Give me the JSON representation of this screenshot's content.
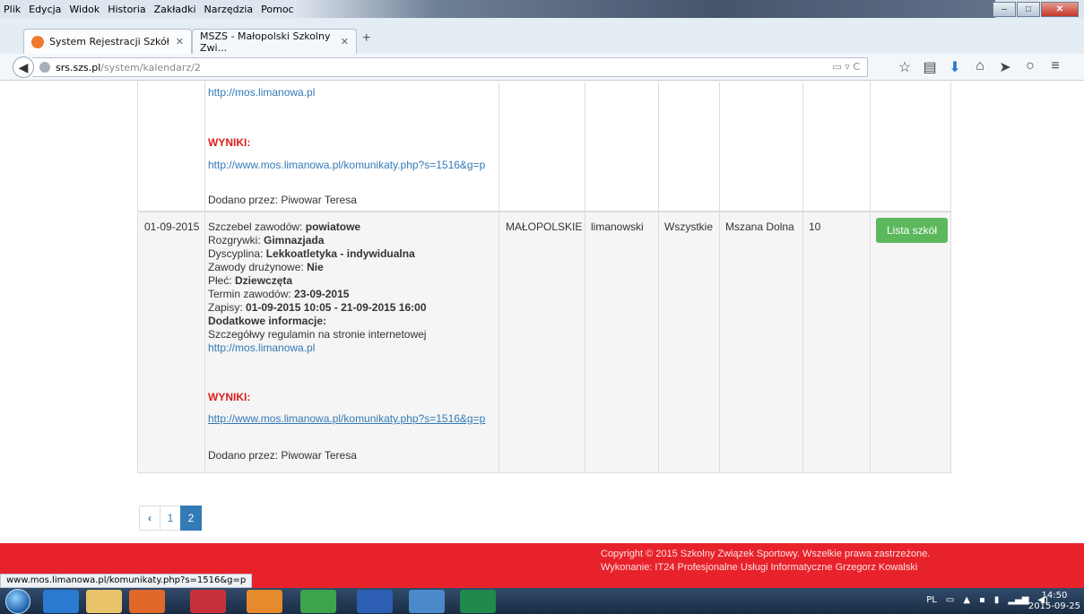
{
  "browser": {
    "menu": [
      "Plik",
      "Edycja",
      "Widok",
      "Historia",
      "Zakładki",
      "Narzędzia",
      "Pomoc"
    ],
    "tabs": [
      {
        "label": "System Rejestracji Szkół",
        "active": true
      },
      {
        "label": "MSZS - Małopolski Szkolny Zwi...",
        "active": false
      }
    ],
    "url_domain": "srs.szs.pl",
    "url_path": "/system/kalendarz/2",
    "status_link": "www.mos.limanowa.pl/komunikaty.php?s=1516&g=p"
  },
  "row1": {
    "link_main": "http://mos.limanowa.pl",
    "results_label": "WYNIKI:",
    "results_link": "http://www.mos.limanowa.pl/komunikaty.php?s=1516&g=p",
    "added_by": "Dodano przez: Piwowar Teresa"
  },
  "row2": {
    "date": "01-09-2015",
    "level_label": "Szczebel zawodów: ",
    "level_value": "powiatowe",
    "games_label": "Rozgrywki: ",
    "games_value": "Gimnazjada",
    "discipline_label": "Dyscyplina: ",
    "discipline_value": "Lekkoatletyka - indywidualna",
    "team_label": "Zawody drużynowe: ",
    "team_value": "Nie",
    "sex_label": "Płeć: ",
    "sex_value": "Dziewczęta",
    "term_label": "Termin zawodów: ",
    "term_value": "23-09-2015",
    "signup_label": "Zapisy: ",
    "signup_value": "01-09-2015 10:05 - 21-09-2015 16:00",
    "extra_label": "Dodatkowe informacje:",
    "extra_text": "Szczegółwy regulamin na stronie internetowej",
    "link_main": "http://mos.limanowa.pl",
    "results_label": "WYNIKI:",
    "results_link": "http://www.mos.limanowa.pl/komunikaty.php?s=1516&g=p",
    "added_by": "Dodano przez: Piwowar Teresa",
    "region": "MAŁOPOLSKIE",
    "county": "limanowski",
    "category": "Wszystkie",
    "town": "Mszana Dolna",
    "count": "10",
    "schools_button": "Lista szkół"
  },
  "pagination": {
    "prev": "‹",
    "pages": [
      "1",
      "2"
    ],
    "active": "2"
  },
  "footer": {
    "copyright": "Copyright © 2015 Szkolny Związek Sportowy. Wszelkie prawa zastrzeżone.",
    "made_by": "Wykonanie: IT24 Profesjonalne Usługi Informatyczne Grzegorz Kowalski"
  },
  "taskbar": {
    "lang": "PL",
    "time": "14:50",
    "date": "2015-09-25"
  }
}
